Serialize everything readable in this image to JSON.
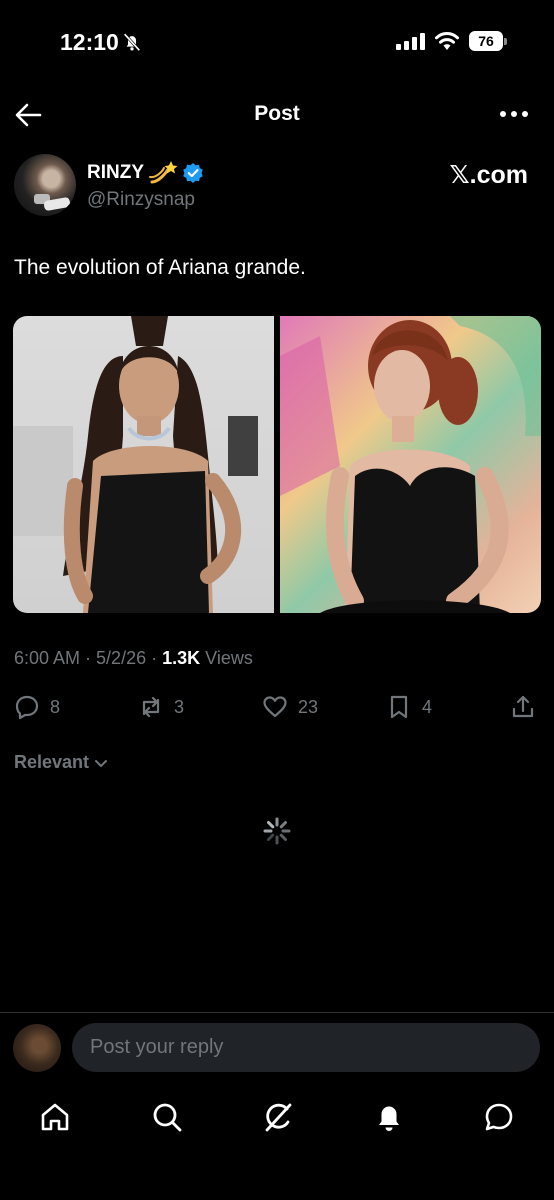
{
  "status_bar": {
    "time": "12:10",
    "battery": "76"
  },
  "header": {
    "title": "Post"
  },
  "post": {
    "author_name": "RINZY",
    "author_emoji": "💫",
    "handle": "@Rinzysnap",
    "source": "𝕏.com",
    "text": "The evolution of Ariana grande.",
    "time": "6:00 AM",
    "date": "5/2/26",
    "views_count": "1.3K",
    "views_label": "Views",
    "sep": " · "
  },
  "actions": {
    "replies": "8",
    "reposts": "3",
    "likes": "23",
    "bookmarks": "4"
  },
  "replies_sort": {
    "label": "Relevant"
  },
  "composer": {
    "placeholder": "Post your reply"
  },
  "icons": {
    "back": "arrow-left-icon",
    "more": "more-horizontal-icon",
    "verified": "verified-badge-icon",
    "reply": "reply-icon",
    "repost": "repost-icon",
    "like": "heart-icon",
    "bookmark": "bookmark-icon",
    "share": "share-icon",
    "nav": [
      "home-icon",
      "search-icon",
      "grok-icon",
      "notifications-icon",
      "messages-icon"
    ]
  },
  "colors": {
    "background": "#000000",
    "text": "#e7e9ea",
    "muted": "#71767b",
    "verified": "#1d9bf0"
  }
}
